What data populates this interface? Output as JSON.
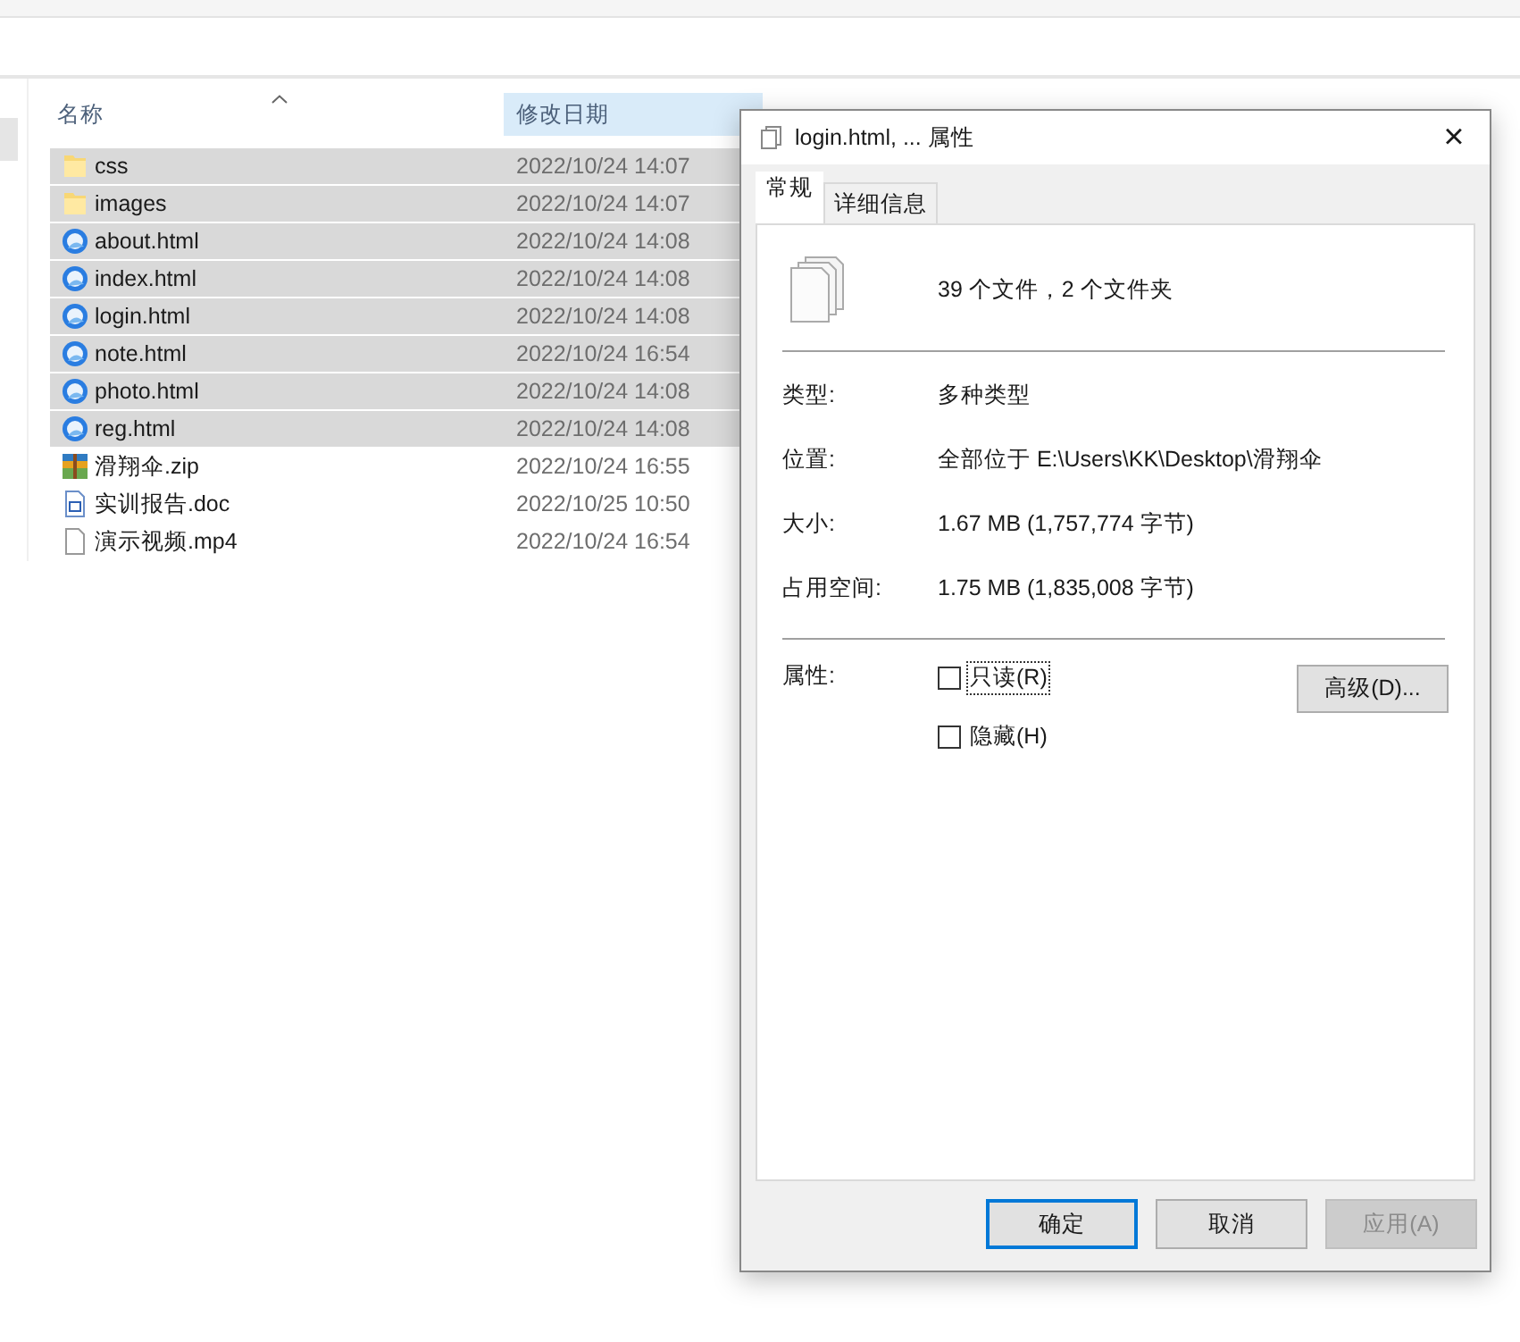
{
  "explorer": {
    "columns": [
      {
        "label": "名称",
        "sorted": true,
        "hovered": false
      },
      {
        "label": "修改日期",
        "sorted": false,
        "hovered": true
      }
    ],
    "files": [
      {
        "name": "css",
        "date": "2022/10/24 14:07",
        "kind": "folder",
        "selected": true
      },
      {
        "name": "images",
        "date": "2022/10/24 14:07",
        "kind": "folder",
        "selected": true
      },
      {
        "name": "about.html",
        "date": "2022/10/24 14:08",
        "kind": "html",
        "selected": true
      },
      {
        "name": "index.html",
        "date": "2022/10/24 14:08",
        "kind": "html",
        "selected": true
      },
      {
        "name": "login.html",
        "date": "2022/10/24 14:08",
        "kind": "html",
        "selected": true
      },
      {
        "name": "note.html",
        "date": "2022/10/24 16:54",
        "kind": "html",
        "selected": true
      },
      {
        "name": "photo.html",
        "date": "2022/10/24 14:08",
        "kind": "html",
        "selected": true
      },
      {
        "name": "reg.html",
        "date": "2022/10/24 14:08",
        "kind": "html",
        "selected": true
      },
      {
        "name": "滑翔伞.zip",
        "date": "2022/10/24 16:55",
        "kind": "zip",
        "selected": false
      },
      {
        "name": "实训报告.doc",
        "date": "2022/10/25 10:50",
        "kind": "doc",
        "selected": false
      },
      {
        "name": "演示视频.mp4",
        "date": "2022/10/24 16:54",
        "kind": "file",
        "selected": false
      }
    ]
  },
  "dialog": {
    "title": "login.html, ... 属性",
    "close": "×",
    "tabs": [
      {
        "label": "常规",
        "selected": true
      },
      {
        "label": "详细信息",
        "selected": false
      }
    ],
    "summary": "39 个文件，2 个文件夹",
    "properties": [
      {
        "label": "类型:",
        "value": "多种类型"
      },
      {
        "label": "位置:",
        "value": "全部位于 E:\\Users\\KK\\Desktop\\滑翔伞"
      },
      {
        "label": "大小:",
        "value": "1.67 MB (1,757,774 字节)"
      },
      {
        "label": "占用空间:",
        "value": "1.75 MB (1,835,008 字节)"
      }
    ],
    "attributes_label": "属性:",
    "checkboxes": [
      {
        "label": "只读(R)",
        "checked": false,
        "focused": true
      },
      {
        "label": "隐藏(H)",
        "checked": false,
        "focused": false
      }
    ],
    "advanced_button": "高级(D)...",
    "buttons": [
      {
        "label": "确定",
        "default": true,
        "disabled": false
      },
      {
        "label": "取消",
        "default": false,
        "disabled": false
      },
      {
        "label": "应用(A)",
        "default": false,
        "disabled": true
      }
    ]
  }
}
